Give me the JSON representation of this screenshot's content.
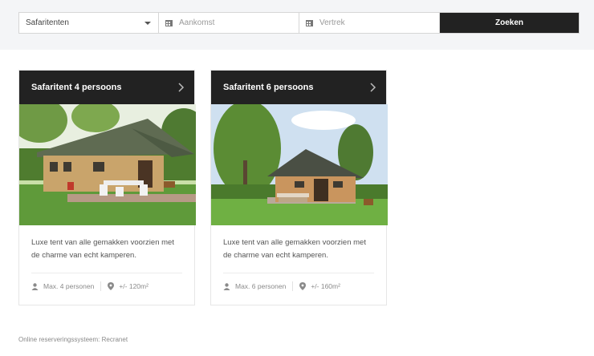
{
  "search": {
    "type_value": "Safaritenten",
    "arrival_placeholder": "Aankomst",
    "departure_placeholder": "Vertrek",
    "button_label": "Zoeken"
  },
  "cards": [
    {
      "title": "Safaritent 4 persoons",
      "description": "Luxe tent van alle gemakken voorzien met de charme van echt kamperen.",
      "persons": "Max. 4 personen",
      "area": "+/- 120m²"
    },
    {
      "title": "Safaritent 6 persoons",
      "description": "Luxe tent van alle gemakken voorzien met de charme van echt kamperen.",
      "persons": "Max. 6 personen",
      "area": "+/- 160m²"
    }
  ],
  "footer": {
    "text": "Online reserveringssysteem: Recranet"
  },
  "colors": {
    "dark": "#222222",
    "band": "#f4f5f7",
    "grass": "#5f9a3a",
    "tent_canvas": "#c9a46b"
  }
}
